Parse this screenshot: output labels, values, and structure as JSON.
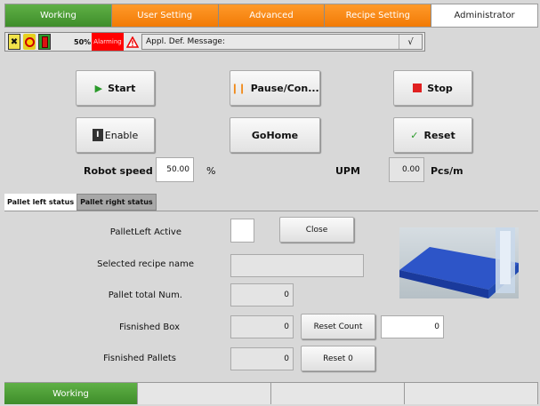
{
  "top_tabs": [
    {
      "label": "Working",
      "style": "green"
    },
    {
      "label": "User Setting",
      "style": "orange"
    },
    {
      "label": "Advanced",
      "style": "orange"
    },
    {
      "label": "Recipe Setting",
      "style": "orange"
    },
    {
      "label": "Administrator",
      "style": "active"
    }
  ],
  "status": {
    "percent": "50%",
    "alarm_label": "Alarming",
    "message": "Appl. Def. Message:",
    "ack_symbol": "√"
  },
  "controls": {
    "start": "Start",
    "pause": "Pause/Con...",
    "stop": "Stop",
    "enable": "Enable",
    "gohome": "GoHome",
    "reset": "Reset",
    "robot_speed_label": "Robot speed",
    "robot_speed_value": "50.00",
    "robot_speed_unit": "%",
    "upm_label": "UPM",
    "upm_value": "0.00",
    "upm_unit": "Pcs/m"
  },
  "pallet_tabs": [
    "Pallet left status",
    "Pallet right status"
  ],
  "pallet": {
    "active_label": "PalletLeft Active",
    "close_button": "Close",
    "recipe_label": "Selected recipe name",
    "recipe_value": "",
    "total_label": "Pallet total Num.",
    "total_value": "0",
    "box_label": "Fisnished Box",
    "box_value": "0",
    "reset_count_button": "Reset Count",
    "reset_count_value": "0",
    "pallets_label": "Fisnished Pallets",
    "pallets_value": "0",
    "reset0_button": "Reset 0"
  },
  "bottom_tabs": [
    "Working",
    "",
    "",
    ""
  ]
}
